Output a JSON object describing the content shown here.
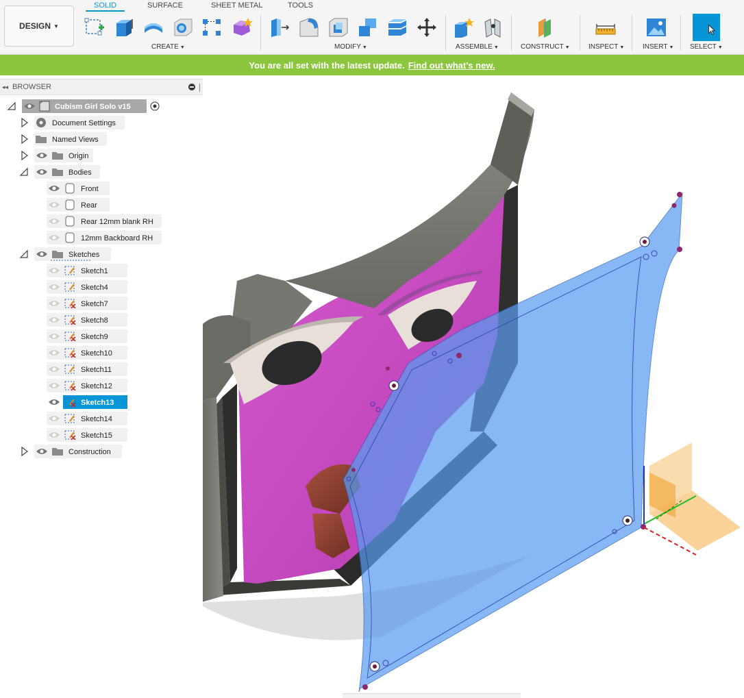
{
  "workspace": {
    "label": "DESIGN"
  },
  "tabs": [
    {
      "label": "SOLID",
      "active": true
    },
    {
      "label": "SURFACE",
      "active": false
    },
    {
      "label": "SHEET METAL",
      "active": false
    },
    {
      "label": "TOOLS",
      "active": false
    }
  ],
  "toolbar": {
    "groups": {
      "create": "CREATE",
      "modify": "MODIFY",
      "assemble": "ASSEMBLE",
      "construct": "CONSTRUCT",
      "inspect": "INSPECT",
      "insert": "INSERT",
      "select": "SELECT"
    },
    "caret": "▾"
  },
  "banner": {
    "message": "You are all set with the latest update.",
    "link": "Find out what's new."
  },
  "browser": {
    "title": "BROWSER",
    "root": "Cubism Girl Solo v15",
    "items": {
      "document_settings": "Document Settings",
      "named_views": "Named Views",
      "origin": "Origin",
      "bodies": "Bodies",
      "front": "Front",
      "rear": "Rear",
      "rear_blank": "Rear 12mm blank RH",
      "backboard": "12mm Backboard RH",
      "sketches": "Sketches",
      "sketch1": "Sketch1",
      "sketch4": "Sketch4",
      "sketch7": "Sketch7",
      "sketch8": "Sketch8",
      "sketch9": "Sketch9",
      "sketch10": "Sketch10",
      "sketch11": "Sketch11",
      "sketch12": "Sketch12",
      "sketch13": "Sketch13",
      "sketch14": "Sketch14",
      "sketch15": "Sketch15",
      "construction": "Construction"
    }
  },
  "colors": {
    "accent": "#0696d7",
    "banner": "#8cc63f",
    "face_magenta": "#c74bc0",
    "frame_gray": "#6f6f6a",
    "sketch_blue": "#5a9cf0"
  }
}
